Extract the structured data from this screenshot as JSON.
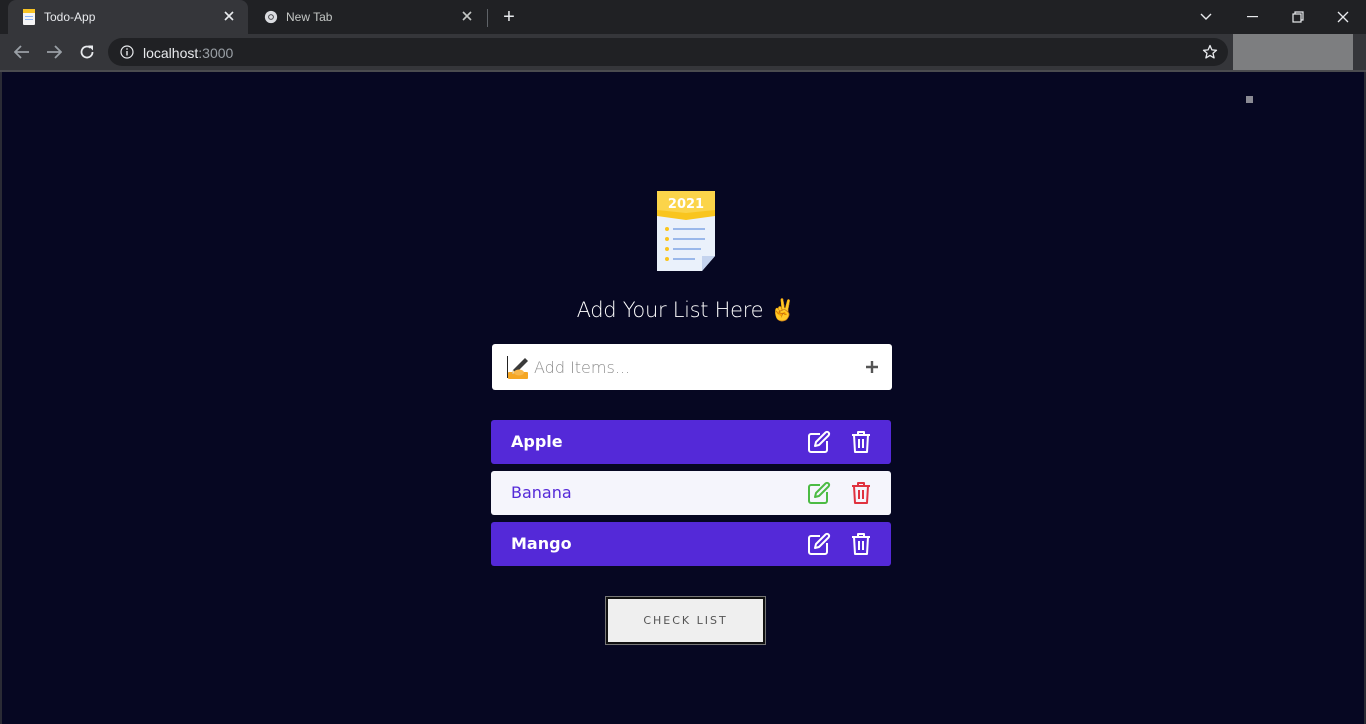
{
  "browser": {
    "tabs": [
      {
        "title": "Todo-App",
        "active": true
      },
      {
        "title": "New Tab",
        "active": false
      }
    ],
    "url_host": "localhost",
    "url_port": ":3000"
  },
  "app": {
    "logo_year": "2021",
    "heading": "Add Your List Here ✌️",
    "input_placeholder": "Add Items...",
    "items": [
      {
        "label": "Apple",
        "style": "purple"
      },
      {
        "label": "Banana",
        "style": "light"
      },
      {
        "label": "Mango",
        "style": "purple"
      }
    ],
    "check_button_label": "CHECK LIST"
  },
  "colors": {
    "background": "#060722",
    "accent": "#5429d8",
    "edit_green": "#4cbb44",
    "delete_red": "#e0323f"
  }
}
